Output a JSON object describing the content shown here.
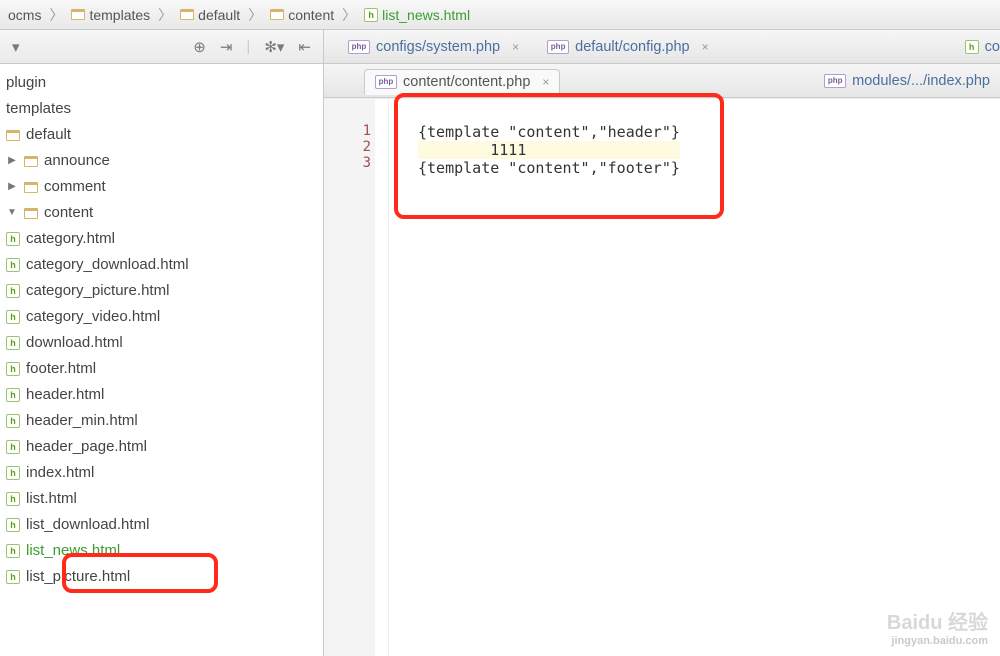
{
  "breadcrumb": {
    "items": [
      {
        "label": "ocms",
        "type": "text"
      },
      {
        "label": "templates",
        "type": "folder"
      },
      {
        "label": "default",
        "type": "folder"
      },
      {
        "label": "content",
        "type": "folder"
      },
      {
        "label": "list_news.html",
        "type": "html",
        "active": true
      }
    ]
  },
  "sidebar": {
    "roots": {
      "plugin": "plugin",
      "templates": "templates"
    },
    "tree": {
      "default": "default",
      "announce": "announce",
      "comment": "comment",
      "content": "content",
      "files": [
        "category.html",
        "category_download.html",
        "category_picture.html",
        "category_video.html",
        "download.html",
        "footer.html",
        "header.html",
        "header_min.html",
        "header_page.html",
        "index.html",
        "list.html",
        "list_download.html",
        "list_news.html",
        "list_picture.html"
      ]
    }
  },
  "tabs_row1": {
    "t1": "configs/system.php",
    "t2": "default/config.php",
    "t3": "co"
  },
  "tabs_row2": {
    "t1": "content/content.php",
    "t2": "modules/.../index.php"
  },
  "editor": {
    "line1": "{template \"content\",\"header\"}",
    "line2": "        1111",
    "line3": "{template \"content\",\"footer\"}",
    "ln1": "1",
    "ln2": "2",
    "ln3": "3"
  },
  "watermark": {
    "brand": "Baidu 经验",
    "sub": "jingyan.baidu.com"
  }
}
